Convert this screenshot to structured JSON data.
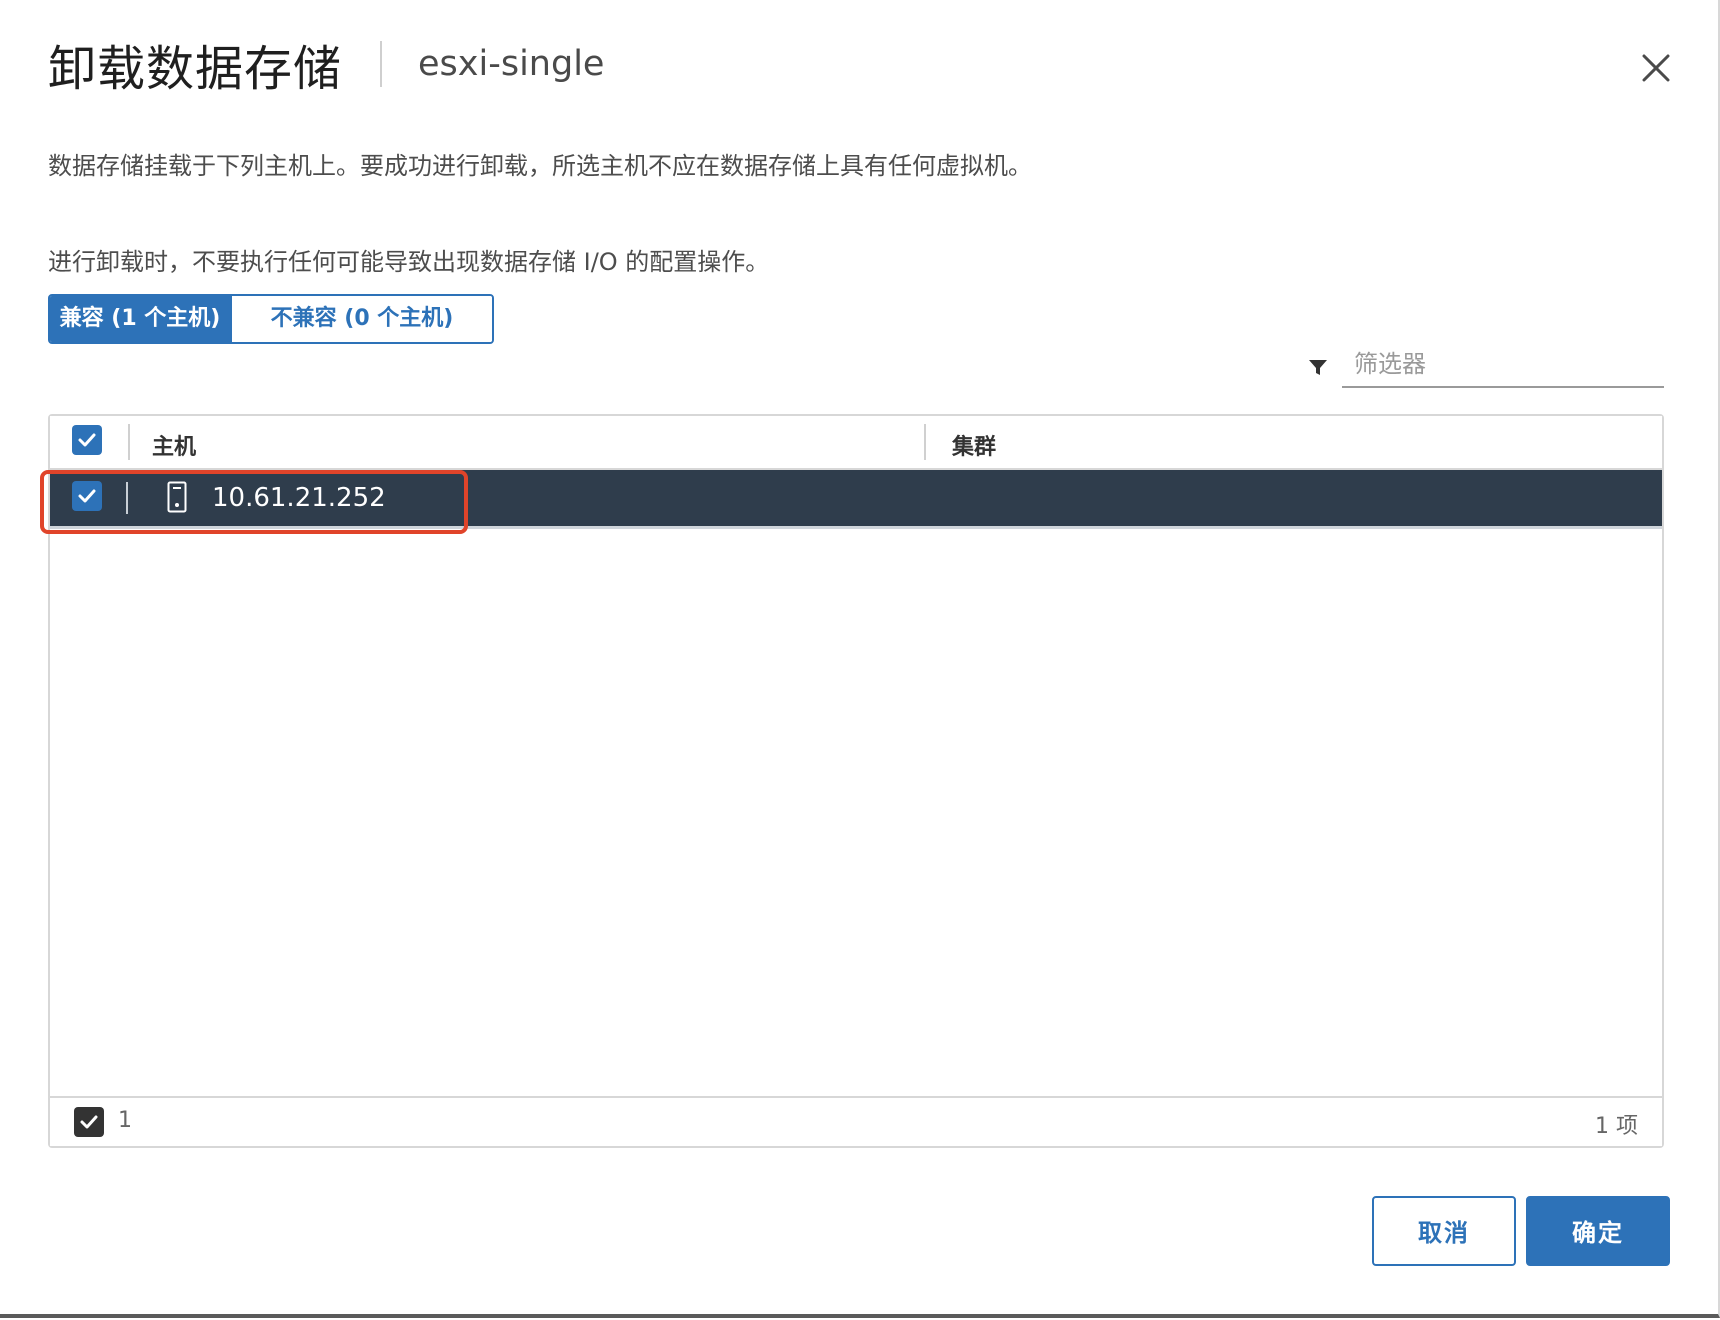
{
  "dialog": {
    "title": "卸载数据存储",
    "subtitle": "esxi-single",
    "description_line1": "数据存储挂载于下列主机上。要成功进行卸载，所选主机不应在数据存储上具有任何虚拟机。",
    "description_line2": "进行卸载时，不要执行任何可能导致出现数据存储 I/O 的配置操作。"
  },
  "tabs": {
    "compatible": "兼容 (1 个主机)",
    "incompatible": "不兼容 (0 个主机)"
  },
  "filter": {
    "placeholder": "筛选器"
  },
  "grid": {
    "columns": [
      "主机",
      "集群"
    ],
    "rows": [
      {
        "host": "10.61.21.252",
        "cluster": "",
        "selected": true
      }
    ],
    "footer": {
      "selected_count": "1",
      "total": "1 项"
    }
  },
  "buttons": {
    "cancel": "取消",
    "ok": "确定"
  },
  "colors": {
    "accent": "#2d72b8",
    "selected_row": "#2f3d4c",
    "highlight": "#e0442a"
  },
  "icons": {
    "close": "close-icon",
    "filter": "filter-icon",
    "host": "server-icon",
    "checkbox": "checkmark-icon"
  }
}
